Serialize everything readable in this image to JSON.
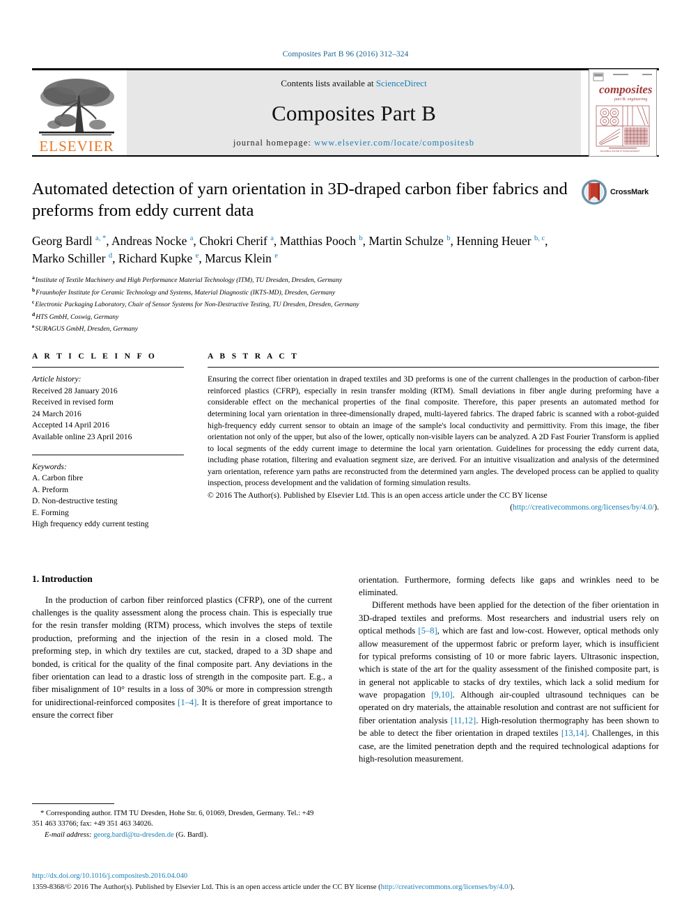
{
  "running_head": "Composites Part B 96 (2016) 312–324",
  "masthead": {
    "publisher_name": "ELSEVIER",
    "contents_prefix": "Contents lists available at ",
    "contents_link": "ScienceDirect",
    "journal_title": "Composites Part B",
    "homepage_prefix": "journal homepage: ",
    "homepage_url": "www.elsevier.com/locate/compositesb",
    "cover_title": "composites",
    "cover_subtitle": "part B: engineering"
  },
  "title_block": {
    "crossmark_label": "CrossMark",
    "title": "Automated detection of yarn orientation in 3D-draped carbon fiber fabrics and preforms from eddy current data",
    "authors": [
      {
        "name": "Georg Bardl",
        "sup": "a, *"
      },
      {
        "name": "Andreas Nocke",
        "sup": "a"
      },
      {
        "name": "Chokri Cherif",
        "sup": "a"
      },
      {
        "name": "Matthias Pooch",
        "sup": "b"
      },
      {
        "name": "Martin Schulze",
        "sup": "b"
      },
      {
        "name": "Henning Heuer",
        "sup": "b, c"
      },
      {
        "name": "Marko Schiller",
        "sup": "d"
      },
      {
        "name": "Richard Kupke",
        "sup": "e"
      },
      {
        "name": "Marcus Klein",
        "sup": "e"
      }
    ],
    "affiliations": [
      {
        "mark": "a",
        "text": "Institute of Textile Machinery and High Performance Material Technology (ITM), TU Dresden, Dresden, Germany"
      },
      {
        "mark": "b",
        "text": "Fraunhofer Institute for Ceramic Technology and Systems, Material Diagnostic (IKTS-MD), Dresden, Germany"
      },
      {
        "mark": "c",
        "text": "Electronic Packaging Laboratory, Chair of Sensor Systems for Non-Destructive Testing, TU Dresden, Dresden, Germany"
      },
      {
        "mark": "d",
        "text": "HTS GmbH, Coswig, Germany"
      },
      {
        "mark": "e",
        "text": "SURAGUS GmbH, Dresden, Germany"
      }
    ]
  },
  "article_info": {
    "heading": "A R T I C L E   I N F O",
    "history_label": "Article history:",
    "history": [
      "Received 28 January 2016",
      "Received in revised form",
      "24 March 2016",
      "Accepted 14 April 2016",
      "Available online 23 April 2016"
    ],
    "keywords_label": "Keywords:",
    "keywords": [
      "A. Carbon fibre",
      "A. Preform",
      "D. Non-destructive testing",
      "E. Forming",
      "High frequency eddy current testing"
    ]
  },
  "abstract": {
    "heading": "A B S T R A C T",
    "text": "Ensuring the correct fiber orientation in draped textiles and 3D preforms is one of the current challenges in the production of carbon-fiber reinforced plastics (CFRP), especially in resin transfer molding (RTM). Small deviations in fiber angle during preforming have a considerable effect on the mechanical properties of the final composite. Therefore, this paper presents an automated method for determining local yarn orientation in three-dimensionally draped, multi-layered fabrics. The draped fabric is scanned with a robot-guided high-frequency eddy current sensor to obtain an image of the sample's local conductivity and permittivity. From this image, the fiber orientation not only of the upper, but also of the lower, optically non-visible layers can be analyzed. A 2D Fast Fourier Transform is applied to local segments of the eddy current image to determine the local yarn orientation. Guidelines for processing the eddy current data, including phase rotation, filtering and evaluation segment size, are derived. For an intuitive visualization and analysis of the determined yarn orientation, reference yarn paths are reconstructed from the determined yarn angles. The developed process can be applied to quality inspection, process development and the validation of forming simulation results.",
    "copyright": "© 2016 The Author(s). Published by Elsevier Ltd. This is an open access article under the CC BY license",
    "license_open": "(",
    "license_url": "http://creativecommons.org/licenses/by/4.0/",
    "license_close": ")."
  },
  "introduction": {
    "number_title": "1. Introduction",
    "left_paragraphs": [
      "In the production of carbon fiber reinforced plastics (CFRP), one of the current challenges is the quality assessment along the process chain. This is especially true for the resin transfer molding (RTM) process, which involves the steps of textile production, preforming and the injection of the resin in a closed mold. The preforming step, in which dry textiles are cut, stacked, draped to a 3D shape and bonded, is critical for the quality of the final composite part. Any deviations in the fiber orientation can lead to a drastic loss of strength in the composite part. E.g., a fiber misalignment of 10° results in a loss of 30% or more in compression strength for unidirectional-reinforced composites [1–4]. It is therefore of great importance to ensure the correct fiber"
    ],
    "right_paragraph_continued": "orientation. Furthermore, forming defects like gaps and wrinkles need to be eliminated.",
    "right_paragraphs": [
      "Different methods have been applied for the detection of the fiber orientation in 3D-draped textiles and preforms. Most researchers and industrial users rely on optical methods [5–8], which are fast and low-cost. However, optical methods only allow measurement of the uppermost fabric or preform layer, which is insufficient for typical preforms consisting of 10 or more fabric layers. Ultrasonic inspection, which is state of the art for the quality assessment of the finished composite part, is in general not applicable to stacks of dry textiles, which lack a solid medium for wave propagation [9,10]. Although air-coupled ultrasound techniques can be operated on dry materials, the attainable resolution and contrast are not sufficient for fiber orientation analysis [11,12]. High-resolution thermography has been shown to be able to detect the fiber orientation in draped textiles [13,14]. Challenges, in this case, are the limited penetration depth and the required technological adaptions for high-resolution measurement."
    ]
  },
  "footnote": {
    "corresponding": "* Corresponding author. ITM TU Dresden, Hohe Str. 6, 01069, Dresden, Germany. Tel.: +49 351 463 33766; fax: +49 351 463 34026.",
    "email_label": "E-mail address:",
    "email": "georg.bardl@tu-dresden.de",
    "email_suffix": "(G. Bardl)."
  },
  "page_footer": {
    "doi": "http://dx.doi.org/10.1016/j.compositesb.2016.04.040",
    "issn_prefix": "1359-8368/© 2016 The Author(s). Published by Elsevier Ltd. This is an open access article under the CC BY license (",
    "issn_link": "http://creativecommons.org/licenses/by/4.0/",
    "issn_suffix": ")."
  },
  "colors": {
    "link": "#1a7db5",
    "elsevier_orange": "#E87722",
    "masthead_bg": "#e7e7e7",
    "crossmark_red": "#c0392b",
    "crossmark_blue": "#5b8aa8"
  }
}
